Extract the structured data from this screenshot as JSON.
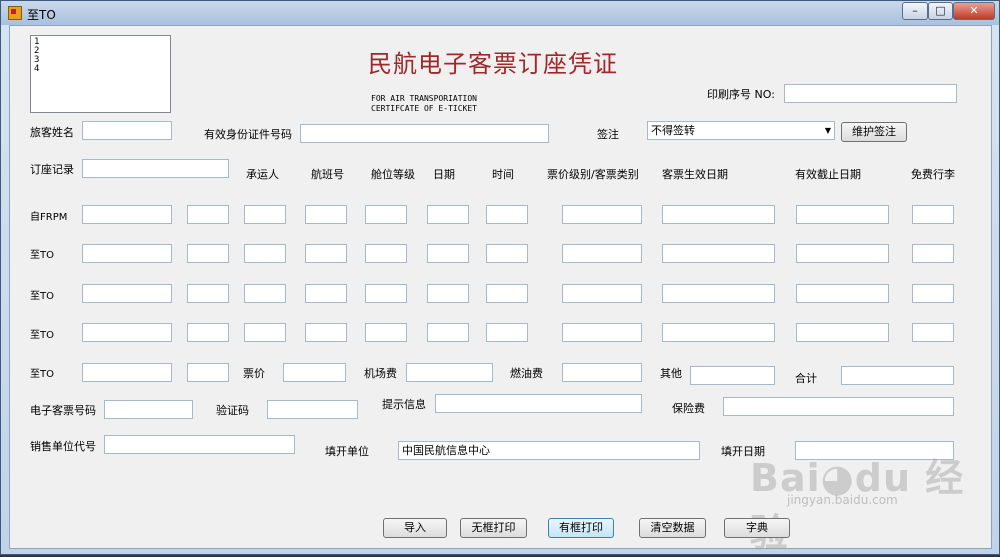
{
  "window": {
    "title": "至TO",
    "min": "–",
    "max": "□",
    "close": "✕"
  },
  "listbox": {
    "items": [
      "1",
      "2",
      "3",
      "4"
    ]
  },
  "header": {
    "title": "民航电子客票订座凭证",
    "subtitle_line1": "FOR AIR TRANSPORIATION",
    "subtitle_line2": "CERTIFCATE OF E-TICKET",
    "print_serial_label": "印刷序号 NO:",
    "print_serial_value": ""
  },
  "passenger": {
    "name_label": "旅客姓名",
    "name_value": "",
    "id_label": "有效身份证件号码",
    "id_value": "",
    "endorse_label": "签注",
    "endorse_selected": "不得签转",
    "maintain_endorse_button": "维护签注"
  },
  "booking": {
    "record_label": "订座记录",
    "record_value": "",
    "columns": [
      "承运人",
      "航班号",
      "舱位等级",
      "日期",
      "时间",
      "票价级别/客票类别",
      "客票生效日期",
      "有效截止日期",
      "免费行李"
    ],
    "row_labels": [
      "自FRPM",
      "至TO",
      "至TO",
      "至TO"
    ]
  },
  "fare_row": {
    "label": "至TO",
    "fare_label": "票价",
    "airport_fee_label": "机场费",
    "fuel_label": "燃油费",
    "other_label": "其他",
    "total_label": "合计"
  },
  "ticket": {
    "eticket_no_label": "电子客票号码",
    "verify_code_label": "验证码",
    "hint_label": "提示信息",
    "insurance_label": "保险费",
    "agent_code_label": "销售单位代号",
    "issuer_label": "填开单位",
    "issuer_value": "中国民航信息中心",
    "issue_date_label": "填开日期"
  },
  "buttons": {
    "import": "导入",
    "print_no_frame": "无框打印",
    "print_frame": "有框打印",
    "clear": "清空数据",
    "dictionary": "字典"
  },
  "watermark": {
    "text": "Bai◕du 经验",
    "sub": "jingyan.baidu.com"
  }
}
